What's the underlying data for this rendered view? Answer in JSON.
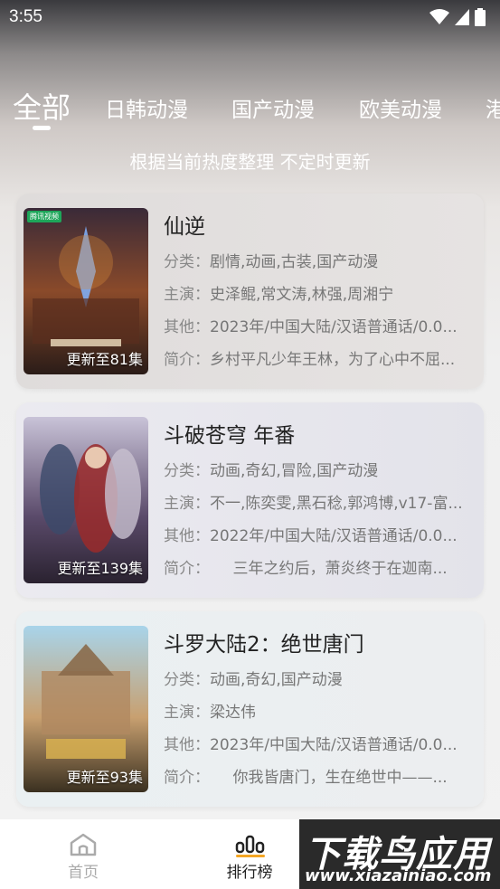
{
  "status_bar": {
    "time": "3:55"
  },
  "tabs": [
    {
      "label": "全部",
      "active": true
    },
    {
      "label": "日韩动漫",
      "active": false
    },
    {
      "label": "国产动漫",
      "active": false
    },
    {
      "label": "欧美动漫",
      "active": false
    },
    {
      "label": "港",
      "active": false
    }
  ],
  "subtitle": "根据当前热度整理 不定时更新",
  "cards": [
    {
      "title": "仙逆",
      "poster_badge": "更新至81集",
      "poster_tag": "腾讯视频",
      "category_key": "分类：",
      "category": "剧情,动画,古装,国产动漫",
      "cast_key": "主演：",
      "cast": "史泽鲲,常文涛,林强,周湘宁",
      "other_key": "其他：",
      "other": "2023年/中国大陆/汉语普通话/0.0...",
      "intro_key": "简介：",
      "intro": "乡村平凡少年王林，为了心中不屈..."
    },
    {
      "title": "斗破苍穹 年番",
      "poster_badge": "更新至139集",
      "poster_tag": "",
      "category_key": "分类：",
      "category": "动画,奇幻,冒险,国产动漫",
      "cast_key": "主演：",
      "cast": "不一,陈奕雯,黑石稔,郭鸿博,v17-富...",
      "other_key": "其他：",
      "other": "2022年/中国大陆/汉语普通话/0.0...",
      "intro_key": "简介：",
      "intro": "　　三年之约后，萧炎终于在迦南..."
    },
    {
      "title": "斗罗大陆2：绝世唐门",
      "poster_badge": "更新至93集",
      "poster_tag": "",
      "category_key": "分类：",
      "category": "动画,奇幻,国产动漫",
      "cast_key": "主演：",
      "cast": "梁达伟",
      "other_key": "其他：",
      "other": "2023年/中国大陆/汉语普通话/0.0...",
      "intro_key": "简介：",
      "intro": "　　你我皆唐门，生在绝世中——..."
    }
  ],
  "bottom_nav": {
    "home_label": "首页",
    "rank_label": "排行榜"
  },
  "watermark": {
    "title": "下载鸟应用",
    "url": "www.xiazainiao.com"
  },
  "colors": {
    "accent": "#f5a623",
    "text_primary": "#222222",
    "text_secondary": "#777777"
  }
}
